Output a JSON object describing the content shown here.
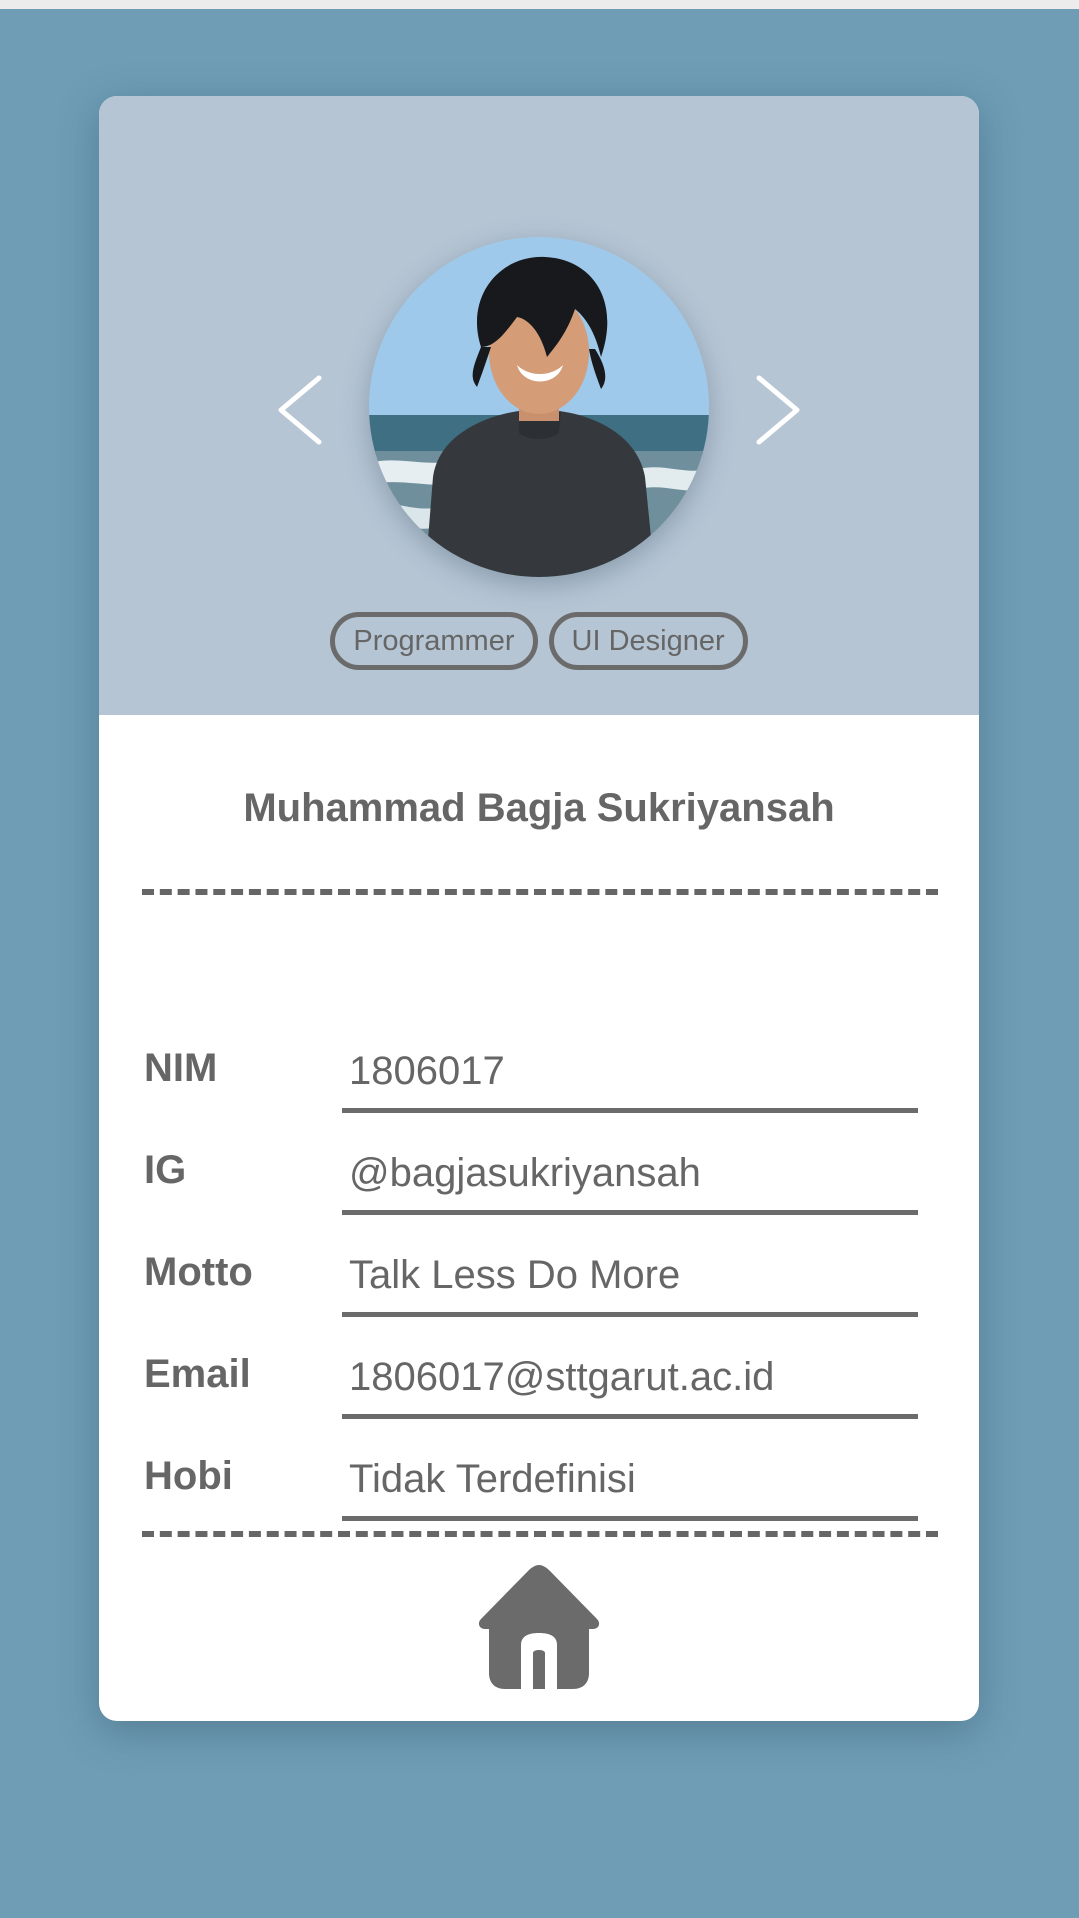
{
  "profile": {
    "name": "Muhammad Bagja Sukriyansah",
    "tags": [
      "Programmer",
      "UI Designer"
    ]
  },
  "fields": [
    {
      "label": "NIM",
      "value": "1806017"
    },
    {
      "label": "IG",
      "value": "@bagjasukriyansah"
    },
    {
      "label": "Motto",
      "value": "Talk Less Do More"
    },
    {
      "label": "Email",
      "value": "1806017@sttgarut.ac.id"
    },
    {
      "label": "Hobi",
      "value": "Tidak Terdefinisi"
    }
  ],
  "icons": {
    "prev": "chevron-left-icon",
    "next": "chevron-right-icon",
    "home": "home-icon"
  },
  "colors": {
    "background": "#6e9db5",
    "header": "#b5c5d4",
    "card": "#ffffff",
    "text": "#666666"
  }
}
